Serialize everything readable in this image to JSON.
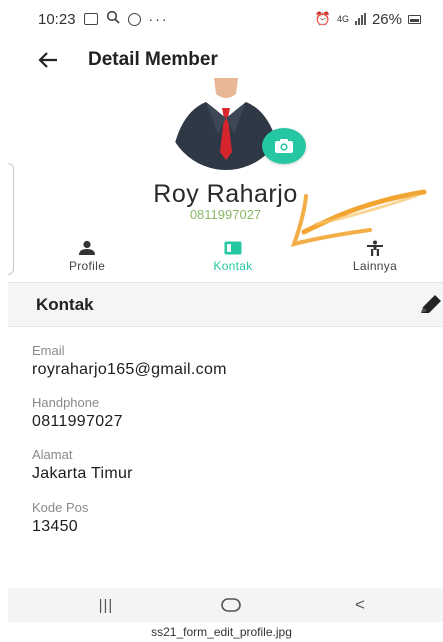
{
  "status_bar": {
    "time": "10:23",
    "dots": "···",
    "network": "4G",
    "battery": "26%"
  },
  "header": {
    "title": "Detail Member",
    "back_icon": "arrow-left-icon"
  },
  "profile": {
    "name": "Roy Raharjo",
    "phone": "0811997027",
    "camera_icon": "camera-icon"
  },
  "tabs": [
    {
      "label": "Profile",
      "icon": "person-icon",
      "active": false
    },
    {
      "label": "Kontak",
      "icon": "contact-card-icon",
      "active": true
    },
    {
      "label": "Lainnya",
      "icon": "accessibility-icon",
      "active": false
    }
  ],
  "section": {
    "title": "Kontak",
    "edit_icon": "pencil-icon"
  },
  "fields": [
    {
      "label": "Email",
      "value": "royraharjo165@gmail.com"
    },
    {
      "label": "Handphone",
      "value": "0811997027"
    },
    {
      "label": "Alamat",
      "value": "Jakarta Timur"
    },
    {
      "label": "Kode Pos",
      "value": "13450"
    }
  ],
  "nav": {
    "recent": "|||",
    "home_icon": "home-circle-icon",
    "back": "<"
  },
  "caption": "ss21_form_edit_profile.jpg",
  "colors": {
    "accent": "#25c7a3",
    "phone_text": "#8ab86a",
    "annotation_arrow": "#f2a533"
  }
}
